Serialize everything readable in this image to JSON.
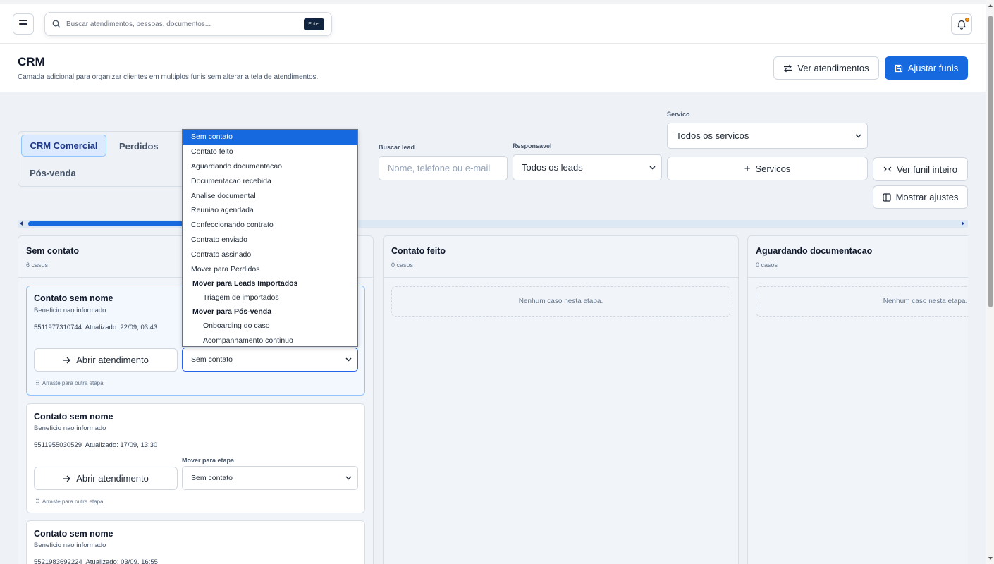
{
  "search": {
    "placeholder": "Buscar atendimentos, pessoas, documentos...",
    "enter_key": "Enter"
  },
  "header": {
    "title": "CRM",
    "subtitle": "Camada adicional para organizar clientes em multiplos funis sem alterar a tela de atendimentos.",
    "view_button": "Ver atendimentos",
    "adjust_button": "Ajustar funis"
  },
  "tabs": [
    {
      "label": "CRM Comercial",
      "active": true
    },
    {
      "label": "Perdidos"
    },
    {
      "label": "Pós-venda"
    }
  ],
  "filters": {
    "search_label": "Buscar lead",
    "search_placeholder": "Nome, telefone ou e-mail",
    "owner_label": "Responsavel",
    "owner_value": "Todos os leads",
    "service_label": "Servico",
    "service_value": "Todos os servicos",
    "services_button": "Servicos",
    "full_funnel_button": "Ver funil inteiro",
    "show_settings_button": "Mostrar ajustes"
  },
  "columns": [
    {
      "title": "Sem contato",
      "count": "6 casos"
    },
    {
      "title": "Contato feito",
      "count": "0 casos",
      "empty": "Nenhum caso nesta etapa."
    },
    {
      "title": "Aguardando documentacao",
      "count": "0 casos",
      "empty": "Nenhum caso nesta etapa."
    }
  ],
  "cards": [
    {
      "name": "Contato sem nome",
      "benefit": "Beneficio nao informado",
      "phone": "5511977310744",
      "updated": "Atualizado: 22/09, 03:43",
      "open": "Abrir atendimento",
      "stage": "Sem contato",
      "drag": "Arraste para outra etapa"
    },
    {
      "name": "Contato sem nome",
      "benefit": "Beneficio nao informado",
      "phone": "5511955030529",
      "updated": "Atualizado: 17/09, 13:30",
      "open": "Abrir atendimento",
      "move_label": "Mover para etapa",
      "stage": "Sem contato",
      "drag": "Arraste para outra etapa"
    },
    {
      "name": "Contato sem nome",
      "benefit": "Beneficio nao informado",
      "phone": "5521983692224",
      "updated": "Atualizado: 03/09, 16:55"
    }
  ],
  "stage_options": {
    "main": [
      "Sem contato",
      "Contato feito",
      "Aguardando documentacao",
      "Documentacao recebida",
      "Analise documental",
      "Reuniao agendada",
      "Confeccionando contrato",
      "Contrato enviado",
      "Contrato assinado",
      "Mover para Perdidos"
    ],
    "group1": {
      "label": "Mover para Leads Importados",
      "items": [
        "Triagem de importados"
      ]
    },
    "group2": {
      "label": "Mover para Pós-venda",
      "items": [
        "Onboarding do caso",
        "Acompanhamento continuo"
      ]
    }
  },
  "colors": {
    "primary": "#1769e0",
    "background": "#eef2f7",
    "highlight": "#dbeafe"
  }
}
